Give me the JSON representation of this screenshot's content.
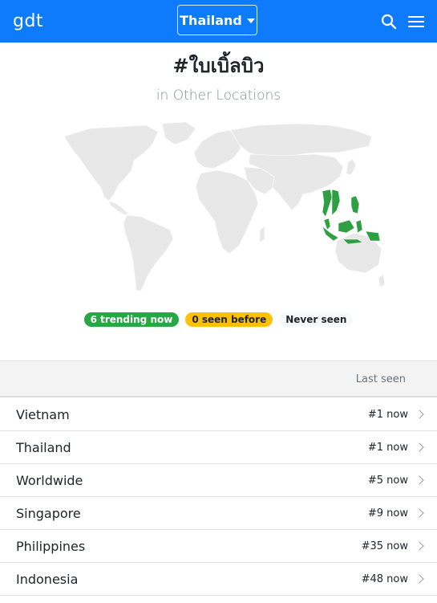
{
  "navbar": {
    "brand": "gdt",
    "country": "Thailand",
    "icons": [
      "search-icon",
      "menu-icon"
    ],
    "color": "#0d7bfb"
  },
  "header": {
    "hashtag": "#ใบเบิ้ลบิว",
    "subtitle": "in Other Locations"
  },
  "map": {
    "highlight_color": "#2ea043",
    "base_color": "#e8e8e8",
    "highlighted_regions": [
      "Vietnam",
      "Thailand",
      "Singapore",
      "Philippines",
      "Indonesia"
    ]
  },
  "legend": {
    "trending": "6 trending now",
    "seen_before": "0 seen before",
    "never_seen": "Never seen"
  },
  "table": {
    "header_last_seen": "Last seen",
    "rows": [
      {
        "name": "Vietnam",
        "rank": "#1 now"
      },
      {
        "name": "Thailand",
        "rank": "#1 now"
      },
      {
        "name": "Worldwide",
        "rank": "#5 now"
      },
      {
        "name": "Singapore",
        "rank": "#9 now"
      },
      {
        "name": "Philippines",
        "rank": "#35 now"
      },
      {
        "name": "Indonesia",
        "rank": "#48 now"
      }
    ]
  }
}
